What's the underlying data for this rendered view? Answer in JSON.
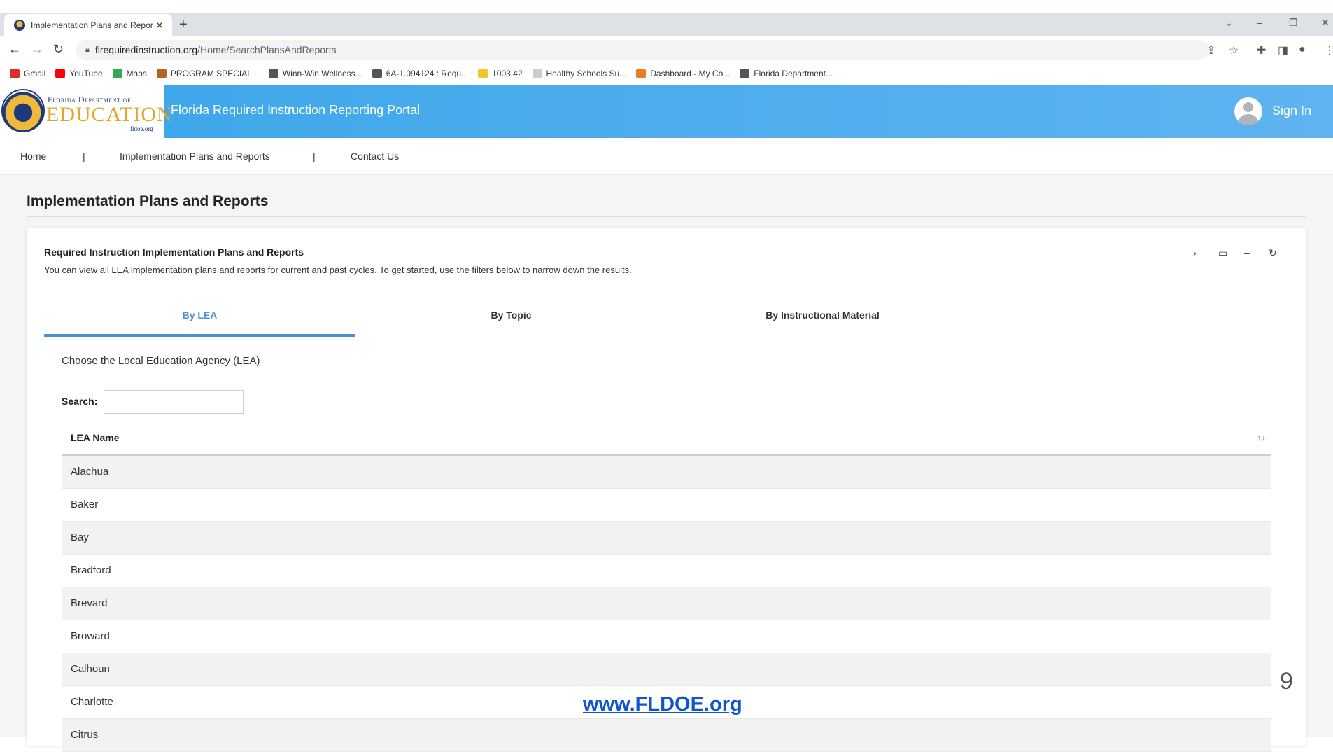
{
  "browser": {
    "tab_title": "Implementation Plans and Repor",
    "url_host": "flrequiredinstruction.org",
    "url_path": "/Home/SearchPlansAndReports",
    "bookmarks": [
      {
        "label": "Gmail",
        "icon": "gmail-icon",
        "color": "#d93025"
      },
      {
        "label": "YouTube",
        "icon": "youtube-icon",
        "color": "#ff0000"
      },
      {
        "label": "Maps",
        "icon": "maps-icon",
        "color": "#34a853"
      },
      {
        "label": "PROGRAM SPECIAL...",
        "icon": "seal-icon",
        "color": "#b5651d"
      },
      {
        "label": "Winn-Win Wellness...",
        "icon": "globe-icon",
        "color": "#555555"
      },
      {
        "label": "6A-1.094124 : Requ...",
        "icon": "globe-icon",
        "color": "#555555"
      },
      {
        "label": "1003.42",
        "icon": "folder-icon",
        "color": "#f4c430"
      },
      {
        "label": "Healthy Schools Su...",
        "icon": "document-icon",
        "color": "#cccccc"
      },
      {
        "label": "Dashboard - My Co...",
        "icon": "dashboard-icon",
        "color": "#e67e22"
      },
      {
        "label": "Florida Department...",
        "icon": "globe-icon",
        "color": "#555555"
      }
    ]
  },
  "header": {
    "logo_line1": "Florida Department of",
    "logo_line2": "EDUCATION",
    "logo_line3": "fldoe.org",
    "portal_title": "Florida Required Instruction Reporting Portal",
    "sign_in": "Sign In"
  },
  "nav": {
    "home": "Home",
    "sep": "|",
    "plans": "Implementation Plans and Reports",
    "contact": "Contact Us"
  },
  "page": {
    "title": "Implementation Plans and Reports",
    "card_title": "Required Instruction Implementation Plans and Reports",
    "card_desc": "You can view all LEA implementation plans and reports for current and past cycles. To get started, use the filters below to narrow down the results.",
    "tabs": [
      "By LEA",
      "By Topic",
      "By Instructional Material"
    ],
    "active_tab": 0,
    "lea_label": "Choose the Local Education Agency (LEA)",
    "search_label": "Search:",
    "search_value": "",
    "table_header": "LEA Name",
    "rows": [
      "Alachua",
      "Baker",
      "Bay",
      "Bradford",
      "Brevard",
      "Broward",
      "Calhoun",
      "Charlotte",
      "Citrus"
    ]
  },
  "slide": {
    "page_number": "9",
    "website": "www.FLDOE.org"
  },
  "colors": {
    "header_blue": "#3aa6e9",
    "active_tab": "#4a90d9",
    "link_blue": "#1155cc"
  }
}
